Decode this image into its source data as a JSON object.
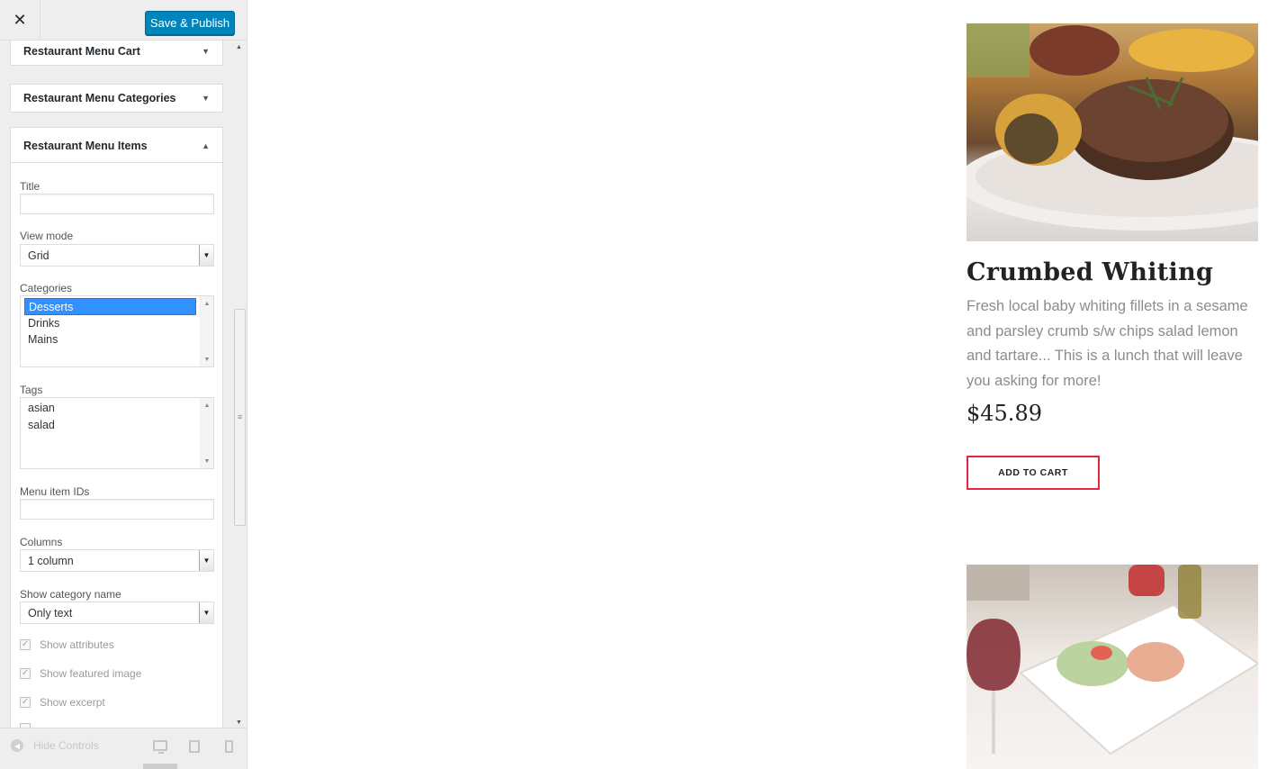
{
  "header": {
    "close_glyph": "✕",
    "publish_label": "Save & Publish"
  },
  "sections": {
    "cart": {
      "title": "Restaurant Menu Cart",
      "arrow": "▼"
    },
    "categories": {
      "title": "Restaurant Menu Categories",
      "arrow": "▼"
    },
    "items": {
      "title": "Restaurant Menu Items",
      "arrow": "▲"
    }
  },
  "form": {
    "title_label": "Title",
    "title_value": "",
    "view_mode_label": "View mode",
    "view_mode_value": "Grid",
    "categories_label": "Categories",
    "categories_options": [
      "Desserts",
      "Drinks",
      "Mains"
    ],
    "categories_selected": "Desserts",
    "tags_label": "Tags",
    "tags_options": [
      "asian",
      "salad"
    ],
    "ids_label": "Menu item IDs",
    "ids_value": "",
    "columns_label": "Columns",
    "columns_value": "1 column",
    "show_category_label": "Show category name",
    "show_category_value": "Only text",
    "checkboxes": [
      {
        "label": "Show attributes",
        "checked": true
      },
      {
        "label": "Show featured image",
        "checked": true
      },
      {
        "label": "Show excerpt",
        "checked": true
      }
    ]
  },
  "footer": {
    "hide_controls_label": "Hide Controls"
  },
  "preview": {
    "items": [
      {
        "title": "Crumbed Whiting",
        "description": "Fresh local baby whiting fillets in a sesame and parsley crumb s/w chips salad lemon and tartare... This is a lunch that will leave you asking for more!",
        "price": "$45.89",
        "button": "ADD TO CART"
      }
    ],
    "accent_color": "#e8263d"
  },
  "colors": {
    "publish_button": "#0085ba",
    "selection": "#3390ff"
  }
}
